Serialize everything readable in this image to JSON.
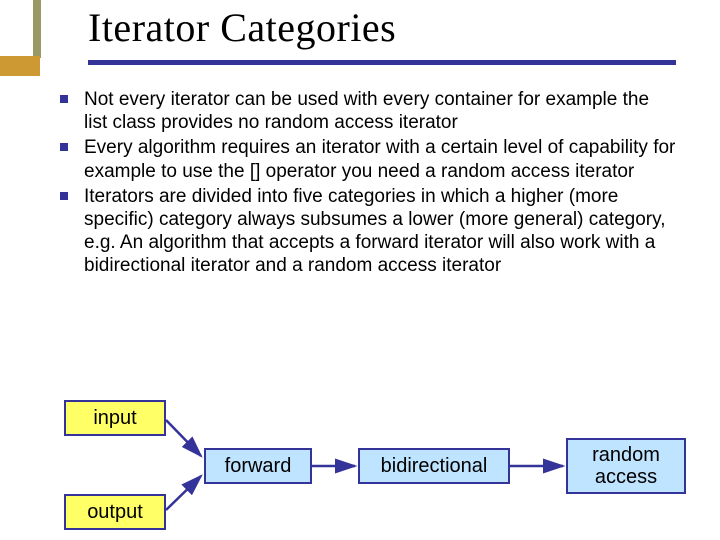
{
  "title": "Iterator Categories",
  "bullets": [
    "Not every iterator can be used with every container for example the list class provides no random access iterator",
    "Every algorithm requires an iterator with a certain level of capability for example to use the [] operator you need a random access iterator",
    "Iterators are divided into five categories in which a higher (more specific) category always subsumes a lower (more general) category, e.g. An algorithm that accepts a forward iterator will also work with a bidirectional iterator and a random access iterator"
  ],
  "diagram": {
    "input": "input",
    "output": "output",
    "forward": "forward",
    "bidirectional": "bidirectional",
    "random": "random access"
  }
}
